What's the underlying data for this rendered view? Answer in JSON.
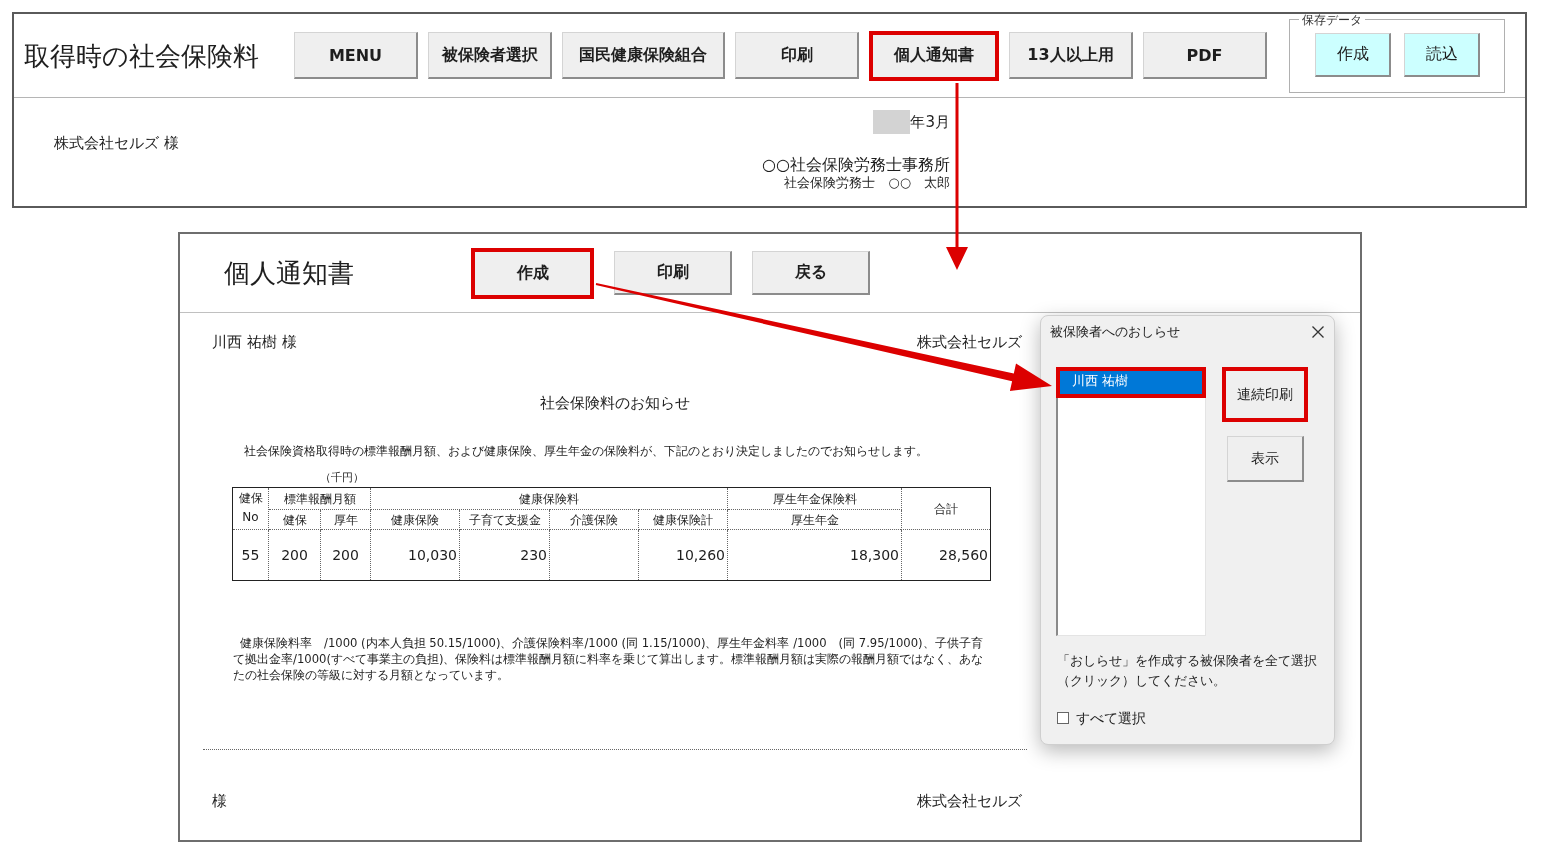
{
  "top_window": {
    "title": "取得時の社会保険料",
    "buttons": [
      {
        "label": "MENU",
        "highlighted": false
      },
      {
        "label": "被保険者選択",
        "highlighted": false
      },
      {
        "label": "国民健康保険組合",
        "highlighted": false
      },
      {
        "label": "印刷",
        "highlighted": false
      },
      {
        "label": "個人通知書",
        "highlighted": true
      },
      {
        "label": "13人以上用",
        "highlighted": false
      },
      {
        "label": "PDF",
        "highlighted": false
      }
    ],
    "save_data": {
      "legend": "保存データ",
      "buttons": [
        {
          "label": "作成"
        },
        {
          "label": "読込"
        }
      ]
    },
    "document": {
      "addressee": "株式会社セルズ 様",
      "date": "年3月",
      "office": "○○社会保険労務士事務所",
      "signer": "社会保険労務士　○○　太郎"
    }
  },
  "notice_window": {
    "title": "個人通知書",
    "buttons": [
      {
        "label": "作成",
        "highlighted": true
      },
      {
        "label": "印刷",
        "highlighted": false
      },
      {
        "label": "戻る",
        "highlighted": false
      }
    ],
    "document": {
      "addressee": "川西 祐樹 様",
      "company": "株式会社セルズ",
      "heading": "社会保険料のお知らせ",
      "intro": "社会保険資格取得時の標準報酬月額、および健康保険、厚生年金の保険料が、下記のとおり決定しましたのでお知らせします。",
      "unit_note": "（千円）",
      "table": {
        "header": [
          {
            "label": "健保 No"
          },
          {
            "label": "標準報酬月額",
            "subcolumns": [
              "健保",
              "厚年"
            ]
          },
          {
            "label": "健康保険料",
            "subcolumns": [
              "健康保険",
              "子育て支援金",
              "介護保険",
              "健康保険計"
            ]
          },
          {
            "label": "厚生年金保険料",
            "subcolumns": [
              "厚生年金"
            ]
          },
          {
            "label": "合計"
          }
        ],
        "rows": [
          {
            "cells": [
              "55",
              "200",
              "200",
              "10,030",
              "230",
              null,
              "10,260",
              "18,300",
              "28,560"
            ]
          }
        ]
      },
      "notes": "健康保険料率　/1000 (内本人負担 50.15/1000)、介護保険料率/1000 (同 1.15/1000)、厚生年金料率 /1000　(同 7.95/1000)、子供子育て拠出金率/1000(すべて事業主の負担)、保険料は標準報酬月額に料率を乗じて算出します。標準報酬月額は実際の報酬月額ではなく、あなたの社会保険の等級に対する月額となっています。",
      "next_addressee": "様",
      "next_company": "株式会社セルズ"
    }
  },
  "dialog": {
    "title": "被保険者へのおしらせ",
    "list_items": [
      {
        "label": "川西 祐樹",
        "selected": true,
        "highlighted": true
      }
    ],
    "buttons": [
      {
        "label": "連続印刷",
        "highlighted": true
      },
      {
        "label": "表示",
        "highlighted": false
      }
    ],
    "instruction": "「おしらせ」を作成する被保険者を全て選択（クリック）してください。",
    "select_all": {
      "label": "すべて選択",
      "checked": false
    }
  }
}
